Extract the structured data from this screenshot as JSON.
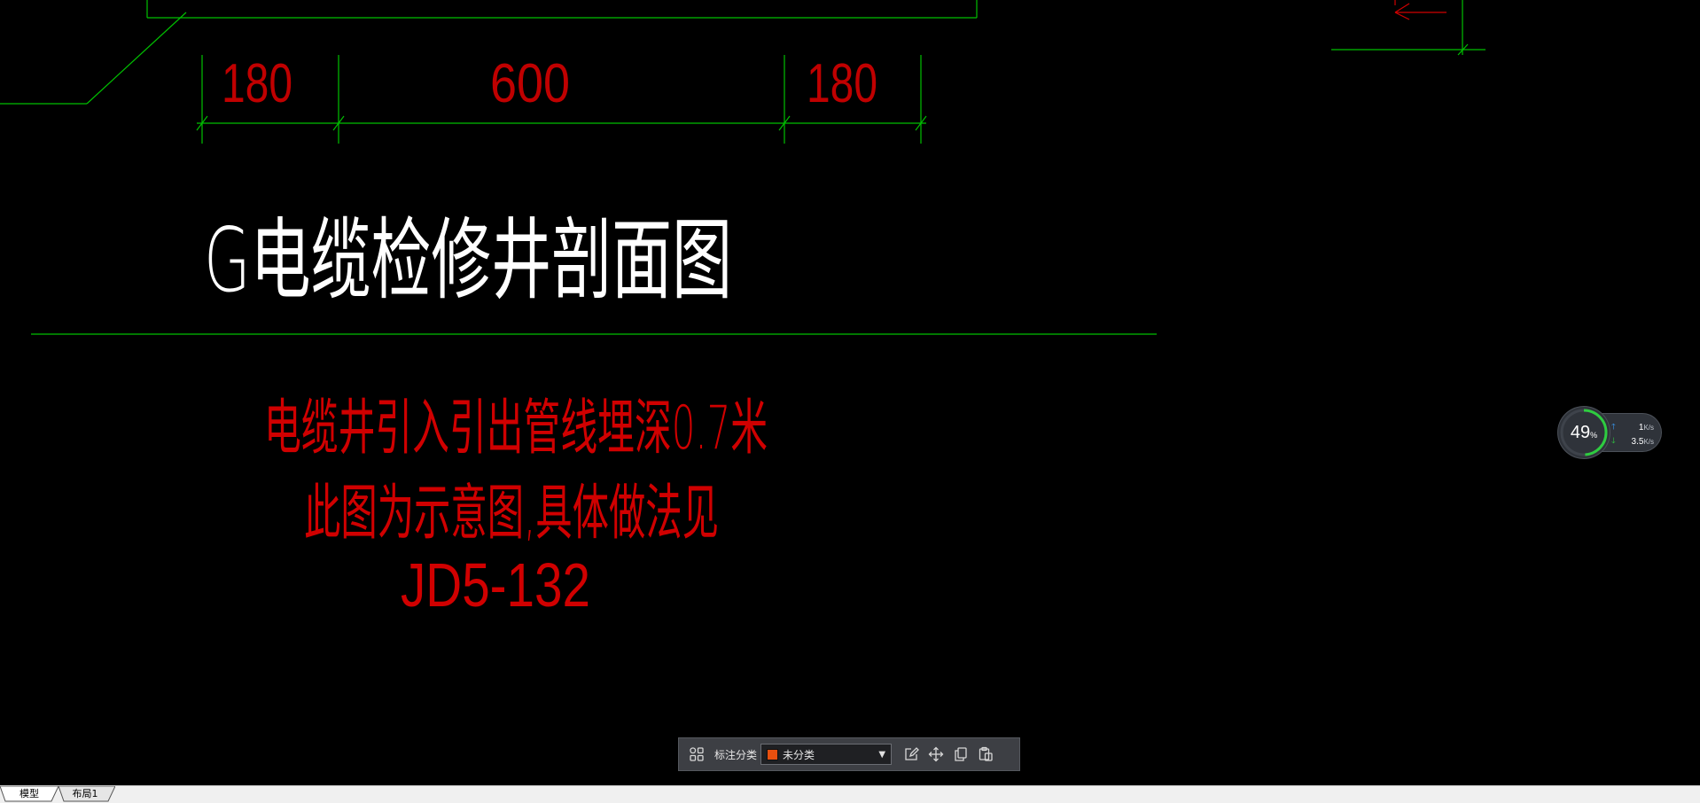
{
  "drawing": {
    "dimensions": [
      "180",
      "600",
      "180"
    ],
    "title": "G电缆检修井剖面图",
    "notes": [
      "电缆井引入引出管线埋深0.7米",
      "此图为示意图,具体做法见",
      "JD5-132"
    ],
    "colors": {
      "background": "#000000",
      "dimension_line": "#00c000",
      "dimension_text": "#c00000",
      "title_text": "#ffffff",
      "note_text": "#d00000",
      "frame_line": "#00c000"
    }
  },
  "toolbar": {
    "category_label": "标注分类",
    "category_value": "未分类",
    "category_swatch": "#e8500f",
    "icons": [
      "grid-icon",
      "edit-icon",
      "move-icon",
      "copy-icon",
      "paste-icon"
    ]
  },
  "net_meter": {
    "percent": "49",
    "percent_unit": "%",
    "upload": "1",
    "upload_unit": "K/s",
    "download": "3.5",
    "download_unit": "K/s",
    "percent_value": 0.49,
    "upload_color": "#3aa0ff",
    "download_color": "#2ecc40"
  },
  "tabs": {
    "model": "模型",
    "layout1": "布局1"
  }
}
